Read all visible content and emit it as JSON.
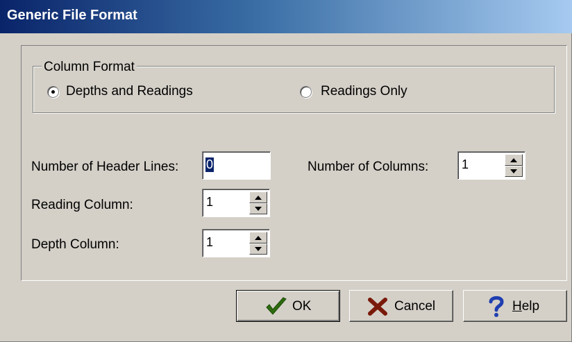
{
  "window": {
    "title": "Generic File Format"
  },
  "column_format": {
    "legend": "Column Format",
    "options": [
      {
        "label": "Depths and Readings",
        "selected": true
      },
      {
        "label": "Readings Only",
        "selected": false
      }
    ]
  },
  "fields": {
    "header_lines": {
      "label": "Number of Header Lines:",
      "value": "0"
    },
    "reading_column": {
      "label": "Reading Column:",
      "value": "1"
    },
    "depth_column": {
      "label": "Depth Column:",
      "value": "1"
    },
    "num_columns": {
      "label": "Number of Columns:",
      "value": "1"
    }
  },
  "buttons": {
    "ok": {
      "label": "OK",
      "icon": "checkmark-icon",
      "icon_color": "#2e6b0e"
    },
    "cancel": {
      "label": "Cancel",
      "icon": "x-icon",
      "icon_color": "#7a1a0a"
    },
    "help": {
      "mnemonic": "H",
      "rest": "elp",
      "icon": "question-icon",
      "icon_color": "#1f3fb0"
    }
  }
}
